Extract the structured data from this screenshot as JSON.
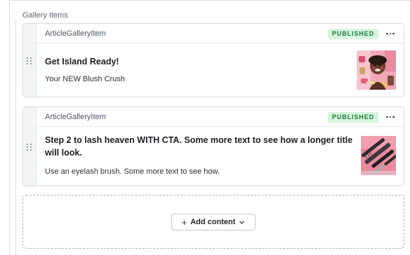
{
  "section": {
    "label": "Gallery Items"
  },
  "items": [
    {
      "type": "ArticleGalleryItem",
      "status": "PUBLISHED",
      "title": "Get Island Ready!",
      "description": "Your NEW Blush Crush",
      "thumbnail_icon": "blush-photo-icon"
    },
    {
      "type": "ArticleGalleryItem",
      "status": "PUBLISHED",
      "title": "Step 2 to lash heaven WITH CTA. Some more text to see how a longer title will look.",
      "description": "Use an eyelash brush. Some more text to see how.",
      "thumbnail_icon": "mascara-photo-icon"
    }
  ],
  "add_content": {
    "label": "Add content",
    "icon": "plus-icon"
  },
  "colors": {
    "status_bg": "#d6f5dc",
    "status_text": "#1e7a3a",
    "border": "#d4d8de"
  }
}
